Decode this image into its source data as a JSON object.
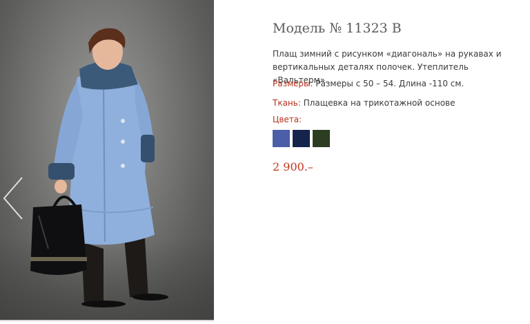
{
  "product": {
    "title": "Модель № 11323 В",
    "description": "Плащ зимний с рисунком «диагональ» на  рукавах и вертикальных деталях полочек. Утеплитель «Вальтерм».",
    "sizes_label": "Размеры:",
    "sizes_value": "Размеры с 50 – 54. Длина -110 см.",
    "fabric_label": "Ткань:",
    "fabric_value": "Плащевка на трикотажной основе",
    "colors_label": "Цвета:",
    "colors": [
      "#4a5fa8",
      "#14244c",
      "#2c3d22"
    ],
    "price": "2 900.–"
  },
  "icons": {
    "prev": "chevron-left-icon"
  }
}
